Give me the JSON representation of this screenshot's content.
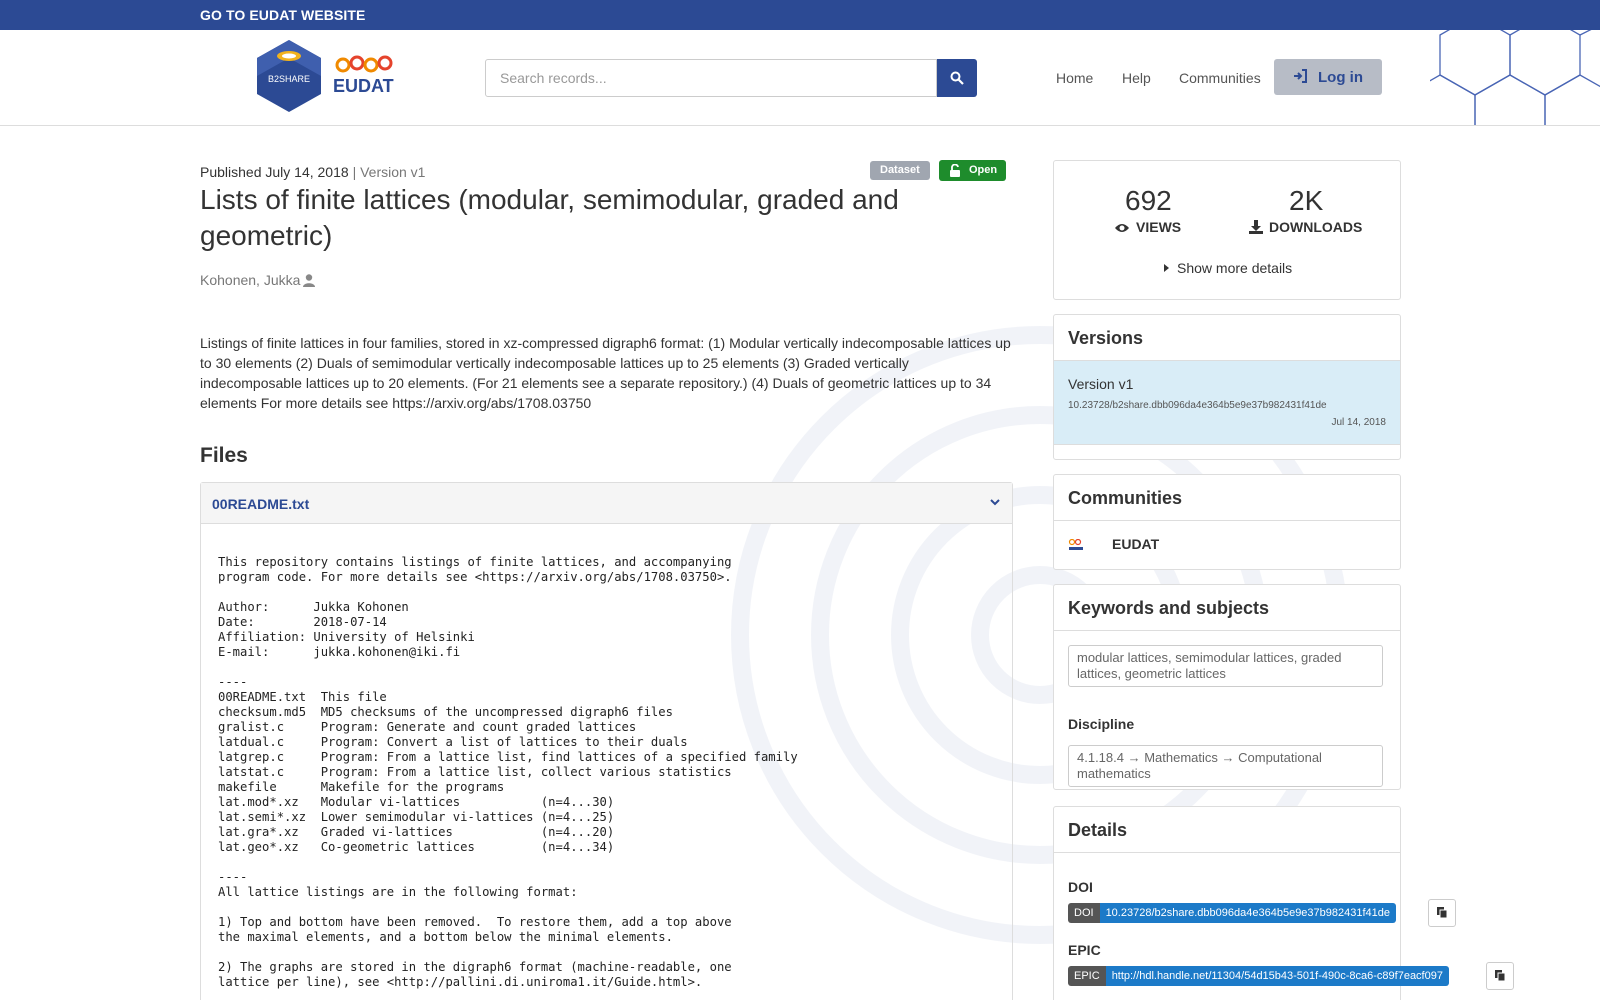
{
  "topbar": {
    "link": "GO TO EUDAT WEBSITE"
  },
  "header": {
    "logo_b2share": "B2SHARE",
    "logo_eudat": "EUDAT",
    "search_placeholder": "Search records...",
    "nav": [
      "Home",
      "Help",
      "Communities"
    ],
    "login": "Log in"
  },
  "record": {
    "published": "Published July 14, 2018",
    "version": "| Version v1",
    "badge_type": "Dataset",
    "badge_access": "Open",
    "title": "Lists of finite lattices (modular, semimodular, graded and geometric)",
    "author": "Kohonen, Jukka",
    "description": "Listings of finite lattices in four families, stored in xz-compressed digraph6 format: (1) Modular vertically indecomposable lattices up to 30 elements (2) Duals of semimodular vertically indecomposable lattices up to 25 elements (3) Graded vertically indecomposable lattices up to 20 elements. (For 21 elements see a separate repository.) (4) Duals of geometric lattices up to 34 elements For more details see https://arxiv.org/abs/1708.03750"
  },
  "files": {
    "heading": "Files",
    "file_name": "00README.txt",
    "readme": "This repository contains listings of finite lattices, and accompanying\nprogram code. For more details see <https://arxiv.org/abs/1708.03750>.\n\nAuthor:      Jukka Kohonen\nDate:        2018-07-14\nAffiliation: University of Helsinki\nE-mail:      jukka.kohonen@iki.fi\n\n----\n00README.txt  This file\nchecksum.md5  MD5 checksums of the uncompressed digraph6 files\ngralist.c     Program: Generate and count graded lattices\nlatdual.c     Program: Convert a list of lattices to their duals\nlatgrep.c     Program: From a lattice list, find lattices of a specified family\nlatstat.c     Program: From a lattice list, collect various statistics\nmakefile      Makefile for the programs\nlat.mod*.xz   Modular vi-lattices           (n=4...30)\nlat.semi*.xz  Lower semimodular vi-lattices (n=4...25)\nlat.gra*.xz   Graded vi-lattices            (n=4...20)\nlat.geo*.xz   Co-geometric lattices         (n=4...34)\n\n----\nAll lattice listings are in the following format:\n\n1) Top and bottom have been removed.  To restore them, add a top above\nthe maximal elements, and a bottom below the minimal elements.\n\n2) The graphs are stored in the digraph6 format (machine-readable, one\nlattice per line), see <http://pallini.di.uniroma1.it/Guide.html>."
  },
  "stats": {
    "views": "692",
    "views_label": "VIEWS",
    "downloads": "2K",
    "downloads_label": "DOWNLOADS",
    "show_more": "Show more details"
  },
  "versions": {
    "heading": "Versions",
    "name": "Version v1",
    "doi": "10.23728/b2share.dbb096da4e364b5e9e37b982431f41de",
    "date": "Jul 14, 2018"
  },
  "communities": {
    "heading": "Communities",
    "name": "EUDAT"
  },
  "keywords": {
    "heading": "Keywords and subjects",
    "keywords": "modular lattices, semimodular lattices, graded lattices, geometric lattices",
    "discipline_label": "Discipline",
    "discipline": "4.1.18.4 → Mathematics → Computational mathematics"
  },
  "details": {
    "heading": "Details",
    "doi_label": "DOI",
    "doi_key": "DOI",
    "doi_value": "10.23728/b2share.dbb096da4e364b5e9e37b982431f41de",
    "epic_label": "EPIC",
    "epic_key": "EPIC",
    "epic_value": "http://hdl.handle.net/11304/54d15b43-501f-490c-8ca6-c89f7eacf097"
  },
  "colors": {
    "brand": "#2c4a94",
    "open": "#1e8c2c",
    "doi": "#1c7ac8",
    "version_bg": "#d9edf7"
  }
}
